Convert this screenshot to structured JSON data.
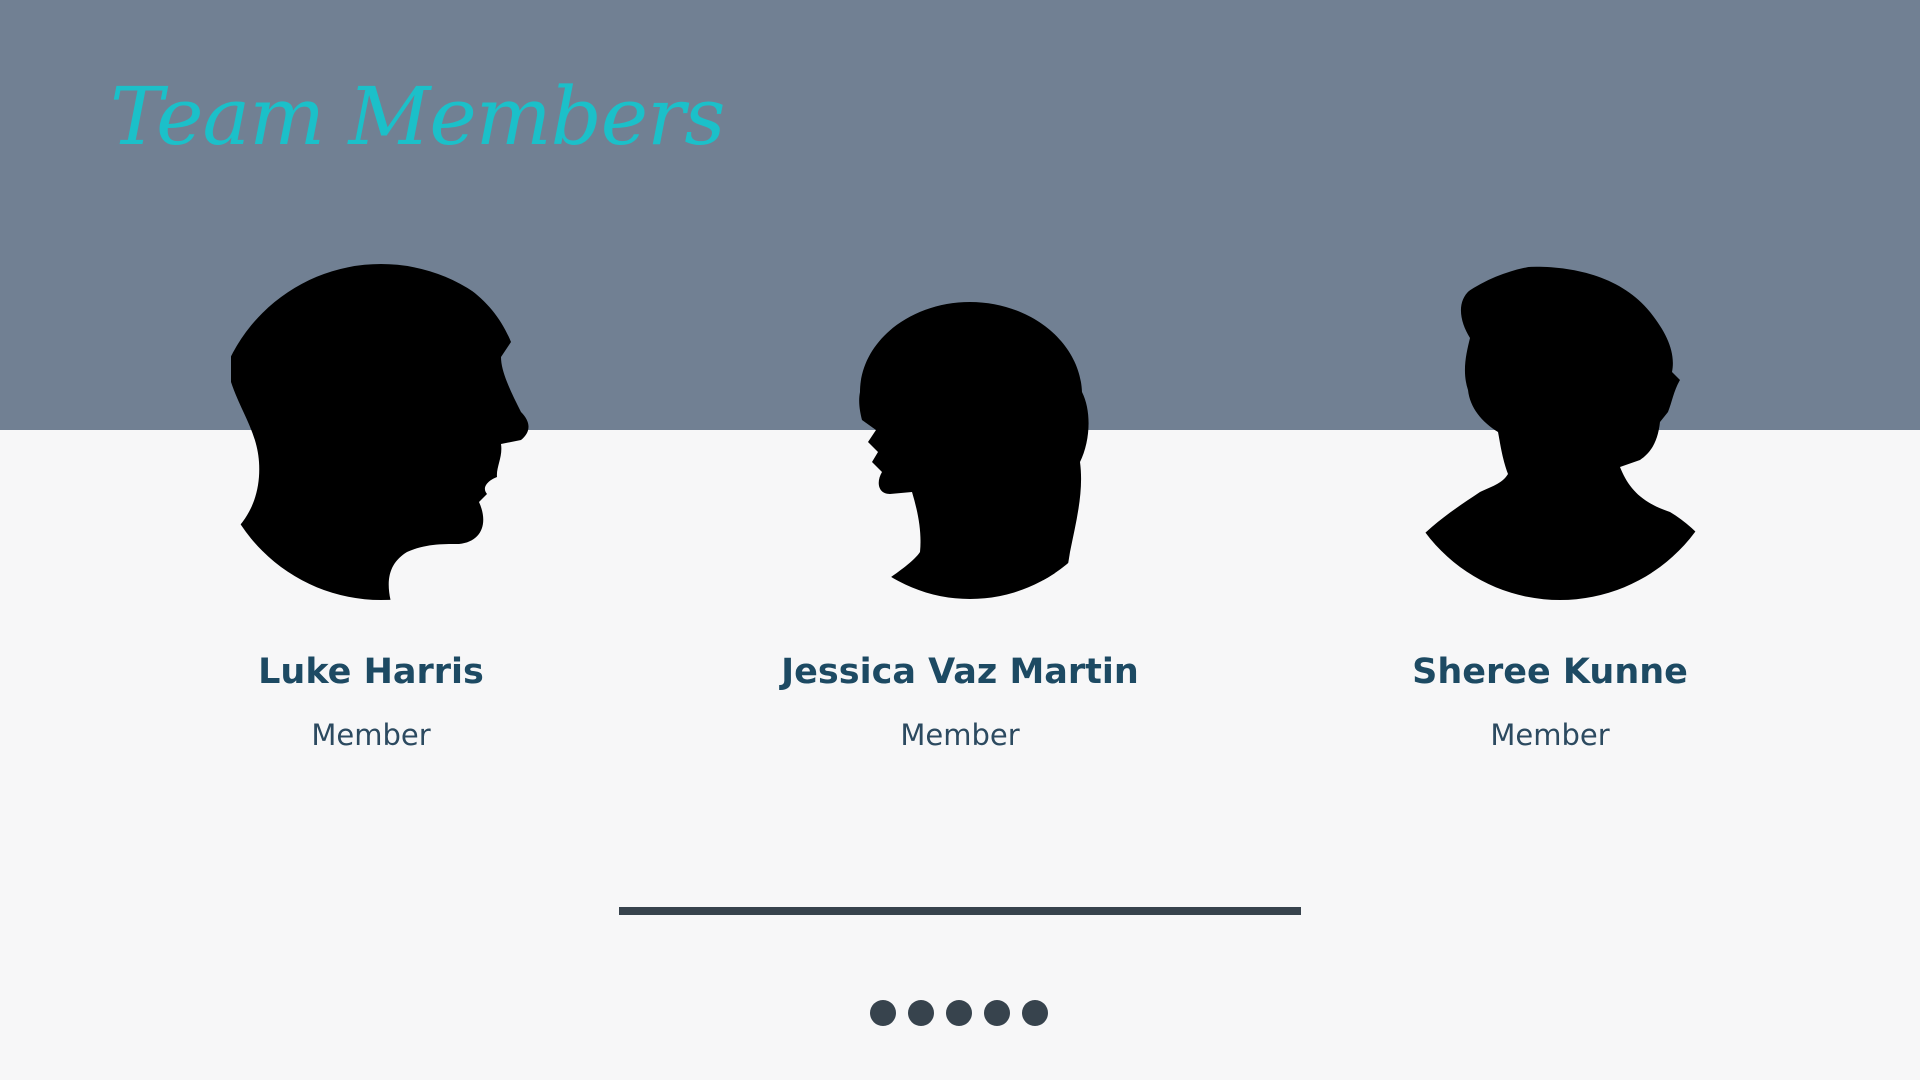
{
  "slide": {
    "title": "Team Members"
  },
  "members": [
    {
      "name": "Luke Harris",
      "role": "Member"
    },
    {
      "name": "Jessica Vaz Martin",
      "role": "Member"
    },
    {
      "name": "Sheree Kunne",
      "role": "Member"
    }
  ],
  "pagination": {
    "dot_count": 5
  },
  "colors": {
    "band": "#718093",
    "background": "#f7f7f8",
    "title": "#1bc0c9",
    "name": "#1d4a63",
    "accent_dark": "#37434d"
  }
}
